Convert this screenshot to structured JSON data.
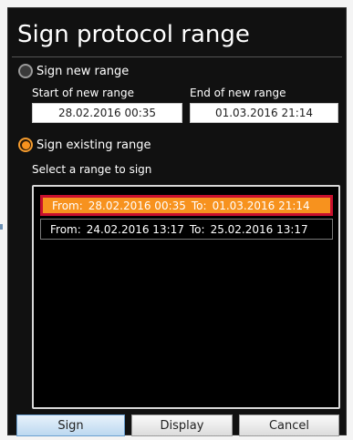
{
  "dialog": {
    "title": "Sign protocol range"
  },
  "sign_new": {
    "label": "Sign new range",
    "checked": false,
    "start_label": "Start of new range",
    "start_value": "28.02.2016 00:35",
    "end_label": "End of new range",
    "end_value": "01.03.2016 21:14"
  },
  "sign_existing": {
    "label": "Sign existing range",
    "checked": true,
    "list_label": "Select a range to sign",
    "ranges": [
      {
        "from_label": "From:",
        "from": "28.02.2016 00:35",
        "to_label": "To:",
        "to": "01.03.2016 21:14",
        "selected": true
      },
      {
        "from_label": "From:",
        "from": "24.02.2016 13:17",
        "to_label": "To:",
        "to": "25.02.2016 13:17",
        "selected": false
      }
    ]
  },
  "buttons": {
    "sign": "Sign",
    "display": "Display",
    "cancel": "Cancel"
  },
  "colors": {
    "accent": "#f7921e",
    "selection_border": "#c8102e",
    "background": "#111111"
  }
}
